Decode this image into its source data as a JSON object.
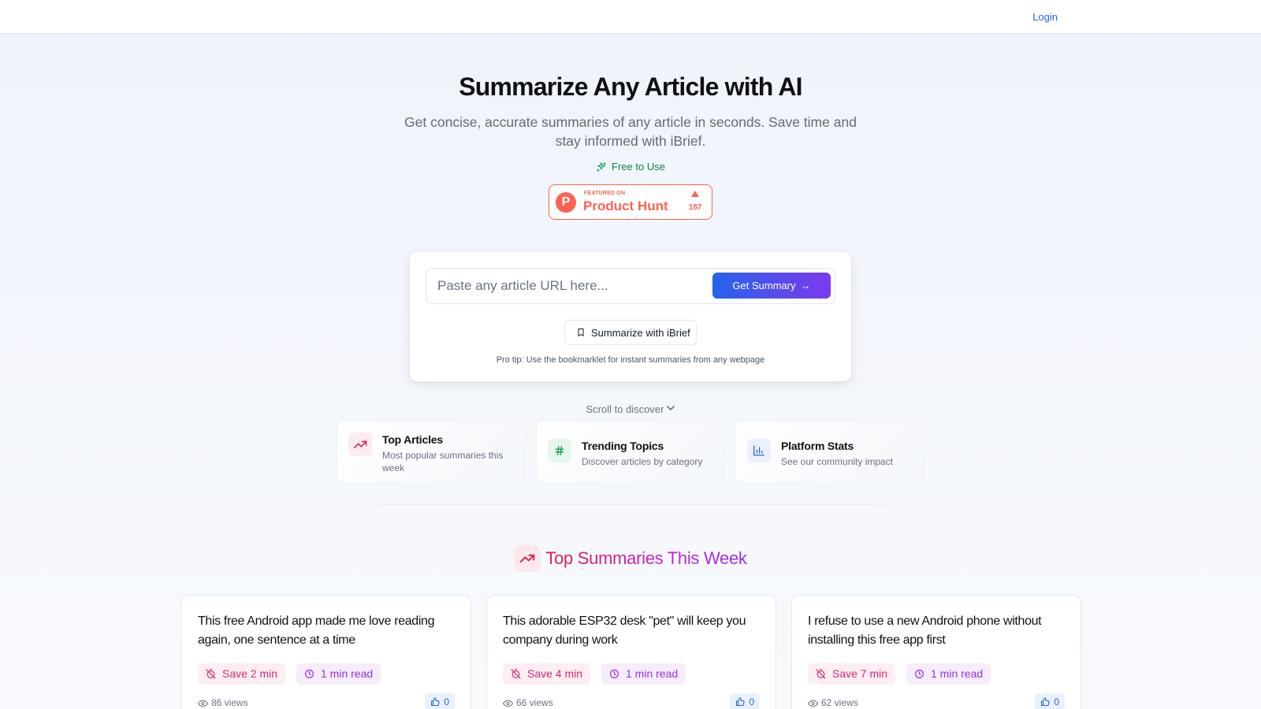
{
  "header": {
    "login_label": "Login"
  },
  "hero": {
    "title": "Summarize Any Article with AI",
    "subtitle": "Get concise, accurate summaries of any article in seconds. Save time and stay informed with iBrief.",
    "free_badge": "Free to Use"
  },
  "product_hunt": {
    "featured_label": "FEATURED ON",
    "name": "Product Hunt",
    "upvotes": "187",
    "brand_color": "#ff6154"
  },
  "search": {
    "placeholder": "Paste any article URL here...",
    "value": "",
    "button_label": "Get Summary",
    "bookmarklet_label": "Summarize with iBrief",
    "pro_tip": "Pro tip: Use the bookmarklet for instant summaries from any webpage"
  },
  "scroll_hint": "Scroll to discover",
  "features": [
    {
      "title": "Top Articles",
      "description": "Most popular summaries this week",
      "icon": "trending-up-icon",
      "color": "#e11d48"
    },
    {
      "title": "Trending Topics",
      "description": "Discover articles by category",
      "icon": "hash-icon",
      "color": "#16a34a"
    },
    {
      "title": "Platform Stats",
      "description": "See our community impact",
      "icon": "bar-chart-icon",
      "color": "#2563eb"
    }
  ],
  "top_section": {
    "title": "Top Summaries This Week",
    "icon": "trending-up-icon"
  },
  "cards": [
    {
      "title": "This free Android app made me love reading again, one sentence at a time",
      "save": "Save 2 min",
      "read": "1 min read",
      "views": "86 views",
      "likes": "0"
    },
    {
      "title": "This adorable ESP32 desk \"pet\" will keep you company during work",
      "save": "Save 4 min",
      "read": "1 min read",
      "views": "66 views",
      "likes": "0"
    },
    {
      "title": "I refuse to use a new Android phone without installing this free app first",
      "save": "Save 7 min",
      "read": "1 min read",
      "views": "62 views",
      "likes": "0"
    }
  ],
  "colors": {
    "accent_blue": "#2563eb",
    "accent_purple": "#7c3aed",
    "pink": "#db2777",
    "green": "#16a34a"
  }
}
